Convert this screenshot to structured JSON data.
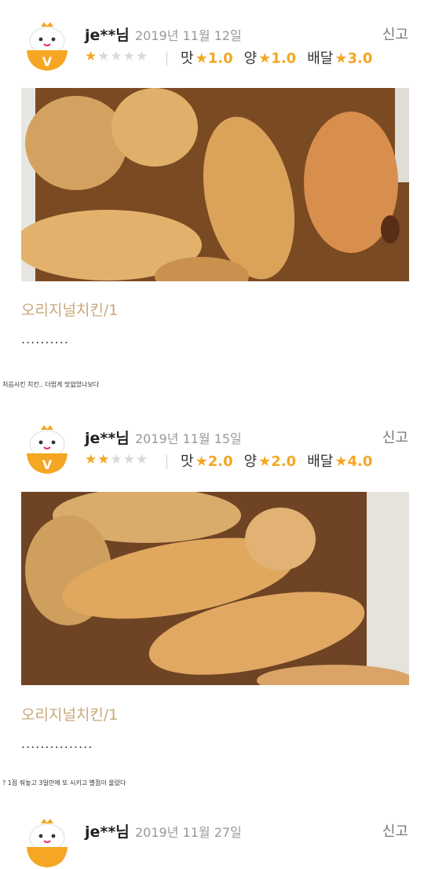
{
  "reviews": [
    {
      "username": "je**님",
      "date": "2019년 11월 12일",
      "report": "신고",
      "rating": 1,
      "taste_label": "맛",
      "taste": "1.0",
      "amount_label": "양",
      "amount": "1.0",
      "delivery_label": "배달",
      "delivery": "3.0",
      "menu": "오리지널치킨/1",
      "comment": "..........",
      "caption": "처음시킨 치킨.. 더럽게 맛없었나보다"
    },
    {
      "username": "je**님",
      "date": "2019년 11월 15일",
      "report": "신고",
      "rating": 2,
      "taste_label": "맛",
      "taste": "2.0",
      "amount_label": "양",
      "amount": "2.0",
      "delivery_label": "배달",
      "delivery": "4.0",
      "menu": "오리지널치킨/1",
      "comment": "...............",
      "caption": "? 1점 줘놓고 3일만에 또 시키고 별점이 올랐다"
    },
    {
      "username": "je**님",
      "date": "2019년 11월 27일",
      "report": "신고"
    }
  ],
  "colors": {
    "star": "#f5a623",
    "star_off": "#d9d9d9",
    "menu": "#c8a878",
    "badge": "#f5a623"
  },
  "icons": {
    "avatar": "bowl-mascot-icon",
    "star": "star-icon"
  }
}
